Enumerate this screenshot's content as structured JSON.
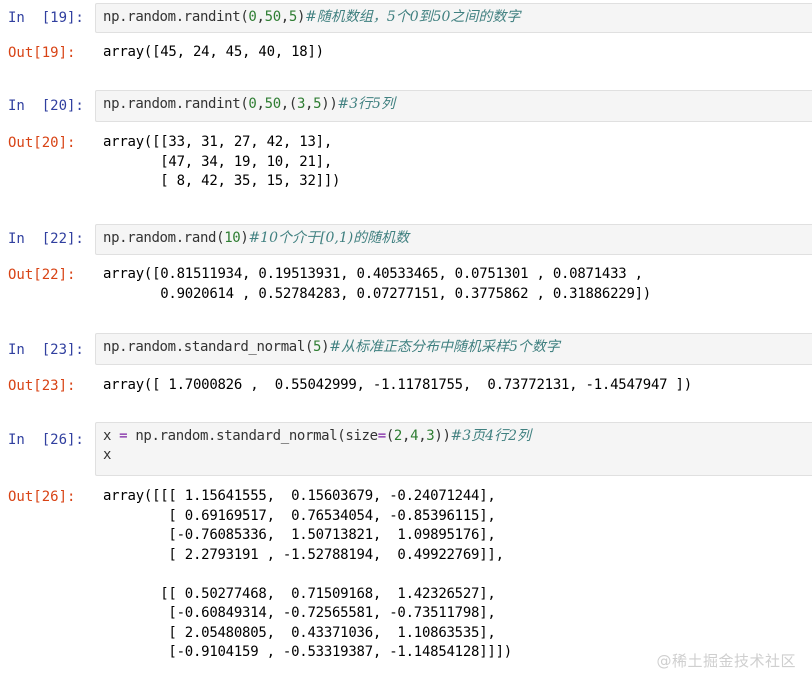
{
  "cells": [
    {
      "in_prompt": "In  [19]:",
      "code": [
        [
          {
            "t": "np.random.randint("
          },
          {
            "t": "0",
            "c": "num"
          },
          {
            "t": ","
          },
          {
            "t": "50",
            "c": "num"
          },
          {
            "t": ","
          },
          {
            "t": "5",
            "c": "num"
          },
          {
            "t": ")"
          },
          {
            "t": "#随机数组，5个0到50之间的数字",
            "c": "cm"
          }
        ]
      ],
      "out_prompt": "Out[19]:",
      "output": "array([45, 24, 45, 40, 18])"
    },
    {
      "in_prompt": "In  [20]:",
      "code": [
        [
          {
            "t": "np.random.randint("
          },
          {
            "t": "0",
            "c": "num"
          },
          {
            "t": ","
          },
          {
            "t": "50",
            "c": "num"
          },
          {
            "t": ",("
          },
          {
            "t": "3",
            "c": "num"
          },
          {
            "t": ","
          },
          {
            "t": "5",
            "c": "num"
          },
          {
            "t": "))"
          },
          {
            "t": "#3行5列",
            "c": "cm"
          }
        ]
      ],
      "out_prompt": "Out[20]:",
      "output": "array([[33, 31, 27, 42, 13],\n       [47, 34, 19, 10, 21],\n       [ 8, 42, 35, 15, 32]])"
    },
    {
      "in_prompt": "In  [22]:",
      "code": [
        [
          {
            "t": "np.random.rand("
          },
          {
            "t": "10",
            "c": "num"
          },
          {
            "t": ")"
          },
          {
            "t": "#10个介于[0,1)的随机数",
            "c": "cm"
          }
        ]
      ],
      "out_prompt": "Out[22]:",
      "output": "array([0.81511934, 0.19513931, 0.40533465, 0.0751301 , 0.0871433 ,\n       0.9020614 , 0.52784283, 0.07277151, 0.3775862 , 0.31886229])"
    },
    {
      "in_prompt": "In  [23]:",
      "code": [
        [
          {
            "t": "np.random.standard_normal("
          },
          {
            "t": "5",
            "c": "num"
          },
          {
            "t": ")"
          },
          {
            "t": "#从标准正态分布中随机采样5个数字",
            "c": "cm"
          }
        ]
      ],
      "out_prompt": "Out[23]:",
      "output": "array([ 1.7000826 ,  0.55042999, -1.11781755,  0.73772131, -1.4547947 ])"
    },
    {
      "in_prompt": "In  [26]:",
      "code": [
        [
          {
            "t": "x "
          },
          {
            "t": "=",
            "c": "op"
          },
          {
            "t": " np.random.standard_normal(size"
          },
          {
            "t": "=",
            "c": "op"
          },
          {
            "t": "("
          },
          {
            "t": "2",
            "c": "num"
          },
          {
            "t": ","
          },
          {
            "t": "4",
            "c": "num"
          },
          {
            "t": ","
          },
          {
            "t": "3",
            "c": "num"
          },
          {
            "t": "))"
          },
          {
            "t": "#3页4行2列",
            "c": "cm"
          }
        ],
        [
          {
            "t": "x"
          }
        ]
      ],
      "out_prompt": "Out[26]:",
      "output": "array([[[ 1.15641555,  0.15603679, -0.24071244],\n        [ 0.69169517,  0.76534054, -0.85396115],\n        [-0.76085336,  1.50713821,  1.09895176],\n        [ 2.2793191 , -1.52788194,  0.49922769]],\n\n       [[ 0.50277468,  0.71509168,  1.42326527],\n        [-0.60849314, -0.72565581, -0.73511798],\n        [ 2.05480805,  0.43371036,  1.10863535],\n        [-0.9104159 , -0.53319387, -1.14854128]]])"
    }
  ],
  "watermark": "@稀土掘金技术社区"
}
